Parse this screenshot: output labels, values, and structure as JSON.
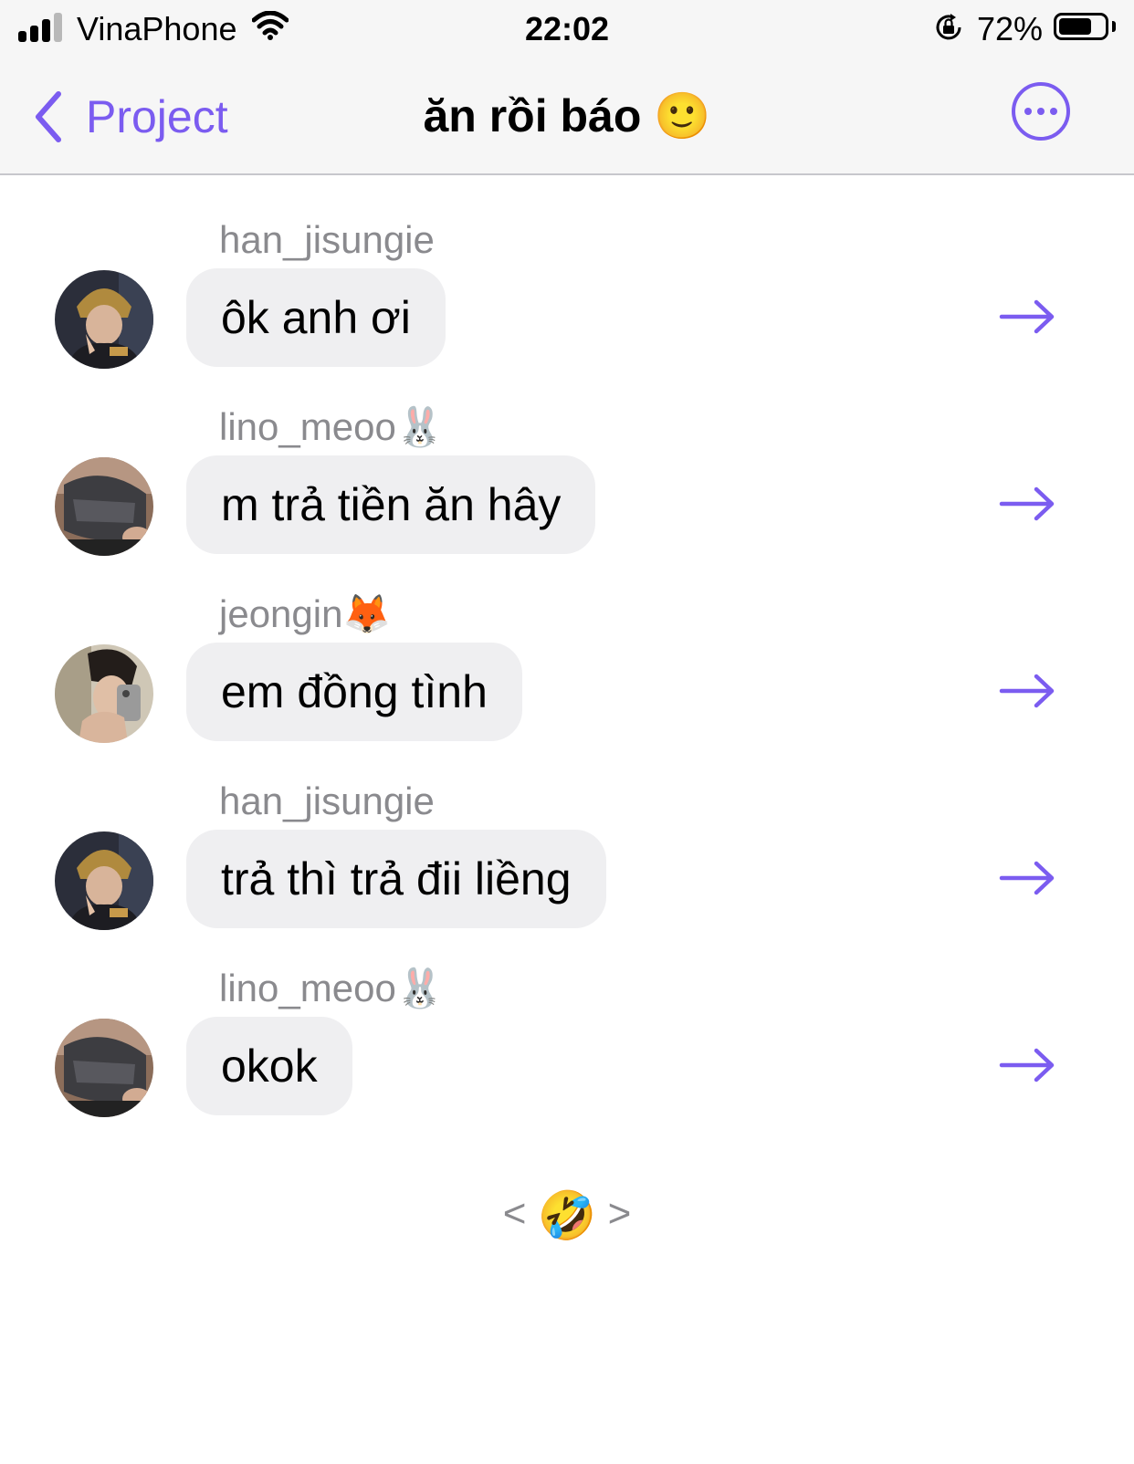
{
  "status_bar": {
    "carrier": "VinaPhone",
    "time": "22:02",
    "battery_percent": "72%",
    "battery_level": 0.72,
    "signal_bars": 3
  },
  "nav": {
    "back_label": "Project",
    "title": "ăn rồi báo",
    "title_emoji": "🙂",
    "accent_color": "#7b5cf0"
  },
  "messages": [
    {
      "sender": "han_jisungie",
      "text": "ôk anh ơi",
      "avatar": "avatar-han-icon"
    },
    {
      "sender": "lino_meoo🐰",
      "text": "m trả tiền ăn hây",
      "avatar": "avatar-lino-icon"
    },
    {
      "sender": "jeongin🦊",
      "text": "em đồng tình",
      "avatar": "avatar-jeongin-icon"
    },
    {
      "sender": "han_jisungie",
      "text": "trả thì trả đii liềng",
      "avatar": "avatar-han-icon"
    },
    {
      "sender": "lino_meoo🐰",
      "text": "okok",
      "avatar": "avatar-lino-icon"
    }
  ],
  "pager": {
    "prev": "<",
    "center_emoji": "🤣",
    "next": ">"
  }
}
